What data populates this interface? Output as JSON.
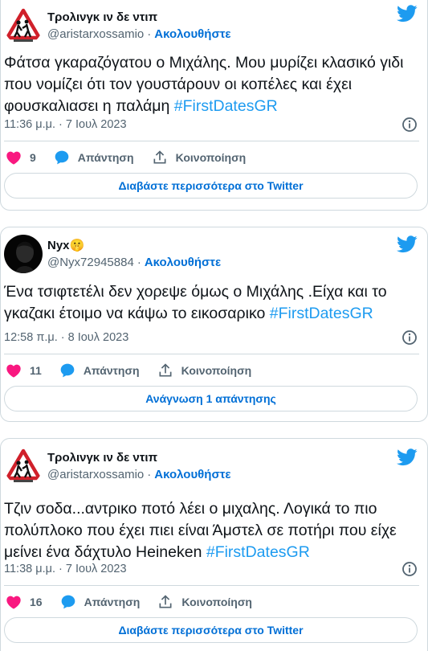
{
  "tweets": [
    {
      "display_name": "Τρολινγκ ιν δε ντιπ",
      "name_emoji": "",
      "handle": "@aristarxossamio",
      "follow_label": "Ακολουθήστε",
      "text": "Φάτσα γκαραζόγατου ο Μιχάλης. Μου μυρίζει κλασικό γιδι που νομίζει ότι τον γουστάρουν οι κοπέλες και έχει φουσκαλιασει η παλάμη ",
      "hashtag": "#FirstDatesGR",
      "timestamp": "11:36 μ.μ. · 7 Ιουλ 2023",
      "likes": "9",
      "reply_label": "Απάντηση",
      "share_label": "Κοινοποίηση",
      "read_more_label": "Διαβάστε περισσότερα στο Twitter"
    },
    {
      "display_name": "Nyx",
      "name_emoji": "🤫",
      "handle": "@Nyx72945884",
      "follow_label": "Ακολουθήστε",
      "text": "Ένα τσιφτετέλι δεν χορεψε όμως ο Μιχάλης .Είχα και το γκαζακι έτοιμο να κάψω το εικοσαρικο ",
      "hashtag": "#FirstDatesGR",
      "timestamp": "12:58 π.μ. · 8 Ιουλ 2023",
      "likes": "11",
      "reply_label": "Απάντηση",
      "share_label": "Κοινοποίηση",
      "read_more_label": "Ανάγνωση 1 απάντησης"
    },
    {
      "display_name": "Τρολινγκ ιν δε ντιπ",
      "name_emoji": "",
      "handle": "@aristarxossamio",
      "follow_label": "Ακολουθήστε",
      "text": "Τζιν σοδα...αντρικο ποτό λέει ο μιχαλης. Λογικά το πιο πολύπλοκο που έχει πιει είναι Άμστελ σε ποτήρι που είχε μείνει ένα δάχτυλο Heineken ",
      "hashtag": "#FirstDatesGR",
      "timestamp": "11:38 μ.μ. · 7 Ιουλ 2023",
      "likes": "16",
      "reply_label": "Απάντηση",
      "share_label": "Κοινοποίηση",
      "read_more_label": "Διαβάστε περισσότερα στο Twitter"
    }
  ],
  "colors": {
    "accent": "#1d9bf0",
    "link": "#006fd6",
    "heart": "#f91880",
    "secondary_text": "#536471",
    "border": "#cfd9de"
  },
  "icons": [
    "twitter-bird-icon",
    "info-icon",
    "heart-icon",
    "reply-bubble-icon",
    "share-icon"
  ]
}
